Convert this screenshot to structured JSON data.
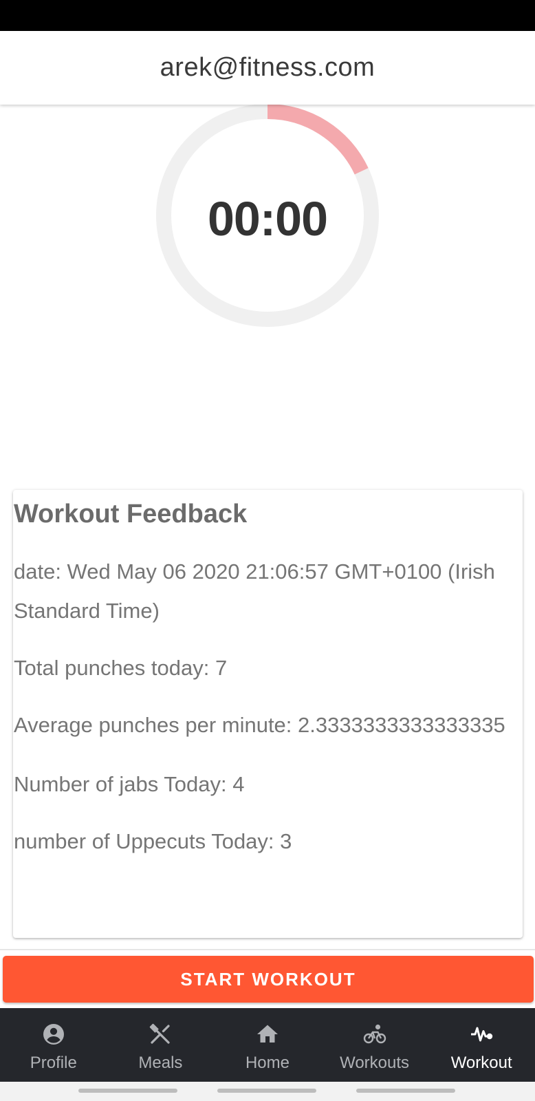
{
  "header": {
    "title": "arek@fitness.com"
  },
  "timer": {
    "display": "00:00",
    "progress_fraction": 0.18,
    "colors": {
      "track": "#f0f0f0",
      "progress": "#f4a9ad"
    }
  },
  "feedback": {
    "title": "Workout Feedback",
    "date_line": "date: Wed May 06 2020 21:06:57 GMT+0100 (Irish Standard Time)",
    "total_punches": "Total punches today: 7",
    "average_ppm": "Average punches per minute: 2.3333333333333335",
    "jabs": "Number of jabs Today: 4",
    "uppercuts": "number of Uppecuts Today: 3"
  },
  "start_button": {
    "label": "START WORKOUT",
    "color": "#ff5733"
  },
  "bottom_nav": {
    "items": [
      {
        "label": "Profile",
        "icon": "account-circle-icon",
        "active": false
      },
      {
        "label": "Meals",
        "icon": "utensils-icon",
        "active": false
      },
      {
        "label": "Home",
        "icon": "home-icon",
        "active": false
      },
      {
        "label": "Workouts",
        "icon": "bicycle-icon",
        "active": false
      },
      {
        "label": "Workout",
        "icon": "activity-pulse-icon",
        "active": true
      }
    ]
  }
}
